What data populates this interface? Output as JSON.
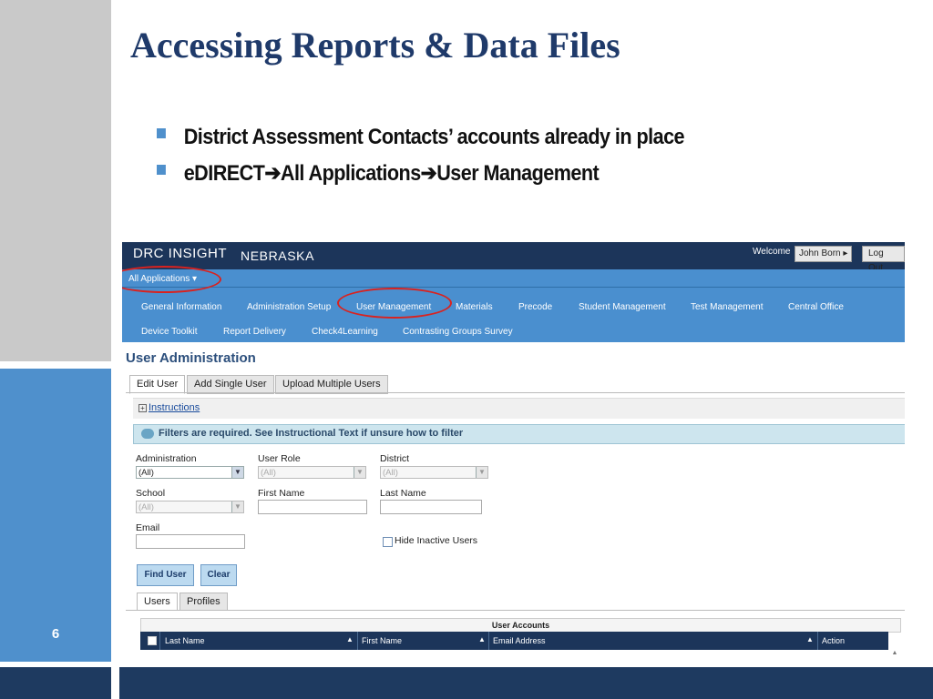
{
  "slide": {
    "title": "Accessing Reports & Data Files",
    "bullets": [
      "District Assessment Contacts’ accounts already in place",
      "eDIRECT➔All Applications➔User Management"
    ],
    "page_number": "6"
  },
  "app": {
    "logo": "DRC INSIGHT",
    "state": "NEBRASKA",
    "welcome_label": "Welcome",
    "user_name": "John Born ▸",
    "logout_label": "Log Out",
    "all_applications": "All Applications ▾",
    "nav_row1": [
      "General Information",
      "Administration Setup",
      "User Management",
      "Materials",
      "Precode",
      "Student Management",
      "Test Management",
      "Central Office"
    ],
    "nav_row2": [
      "Device Toolkit",
      "Report Delivery",
      "Check4Learning",
      "Contrasting Groups Survey"
    ]
  },
  "user_admin": {
    "title": "User Administration",
    "tabs": [
      "Edit User",
      "Add Single User",
      "Upload Multiple Users"
    ],
    "instructions_link": "Instructions",
    "filters_notice": "Filters are required. See Instructional Text if unsure how to filter",
    "filters": {
      "administration": {
        "label": "Administration",
        "value": "(All)"
      },
      "user_role": {
        "label": "User Role",
        "value": "(All)"
      },
      "district": {
        "label": "District",
        "value": "(All)"
      },
      "school": {
        "label": "School",
        "value": "(All)"
      },
      "first_name": {
        "label": "First Name",
        "value": ""
      },
      "last_name": {
        "label": "Last Name",
        "value": ""
      },
      "email": {
        "label": "Email",
        "value": ""
      },
      "hide_inactive": {
        "label": "Hide Inactive Users",
        "checked": false
      }
    },
    "find_user_label": "Find User",
    "clear_label": "Clear",
    "result_tabs": [
      "Users",
      "Profiles"
    ],
    "table": {
      "title": "User Accounts",
      "columns": [
        "Last Name",
        "First Name",
        "Email Address",
        "Action"
      ],
      "rows": []
    }
  },
  "colors": {
    "slide_title": "#1f3a6a",
    "header_navy": "#1c355a",
    "nav_blue": "#4a8fcf",
    "accent_blue": "#4f90cc",
    "highlight_red": "#d9221f"
  }
}
